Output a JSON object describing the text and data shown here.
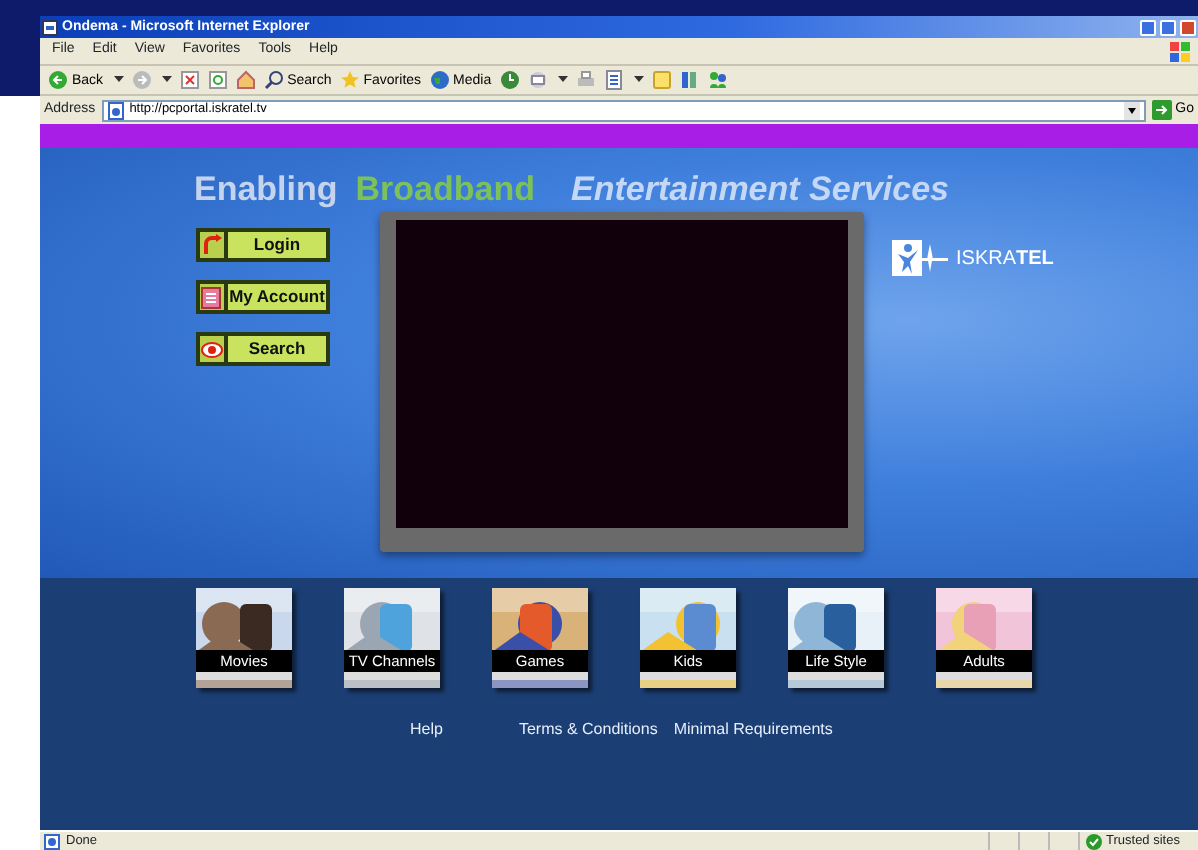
{
  "window": {
    "title": "Ondema - Microsoft Internet Explorer"
  },
  "menu": [
    "File",
    "Edit",
    "View",
    "Favorites",
    "Tools",
    "Help"
  ],
  "toolbar": [
    {
      "kind": "back",
      "label": "Back",
      "has_menu": true
    },
    {
      "kind": "forward",
      "has_menu": true
    },
    {
      "kind": "stop",
      "has_menu": false
    },
    {
      "kind": "refresh",
      "has_menu": false
    },
    {
      "kind": "home",
      "has_menu": false
    },
    {
      "kind": "search",
      "label": "Search",
      "has_menu": false
    },
    {
      "kind": "favorites",
      "label": "Favorites",
      "has_menu": false
    },
    {
      "kind": "media",
      "label": "Media",
      "has_menu": false
    },
    {
      "kind": "history",
      "has_menu": false
    },
    {
      "kind": "mail",
      "has_menu": true
    },
    {
      "kind": "print",
      "has_menu": false
    },
    {
      "kind": "edit",
      "has_menu": true
    },
    {
      "kind": "note",
      "has_menu": false
    },
    {
      "kind": "research",
      "has_menu": false
    },
    {
      "kind": "messenger",
      "has_menu": false
    }
  ],
  "address": {
    "label": "Address",
    "value": "http://pcportal.iskratel.tv",
    "go": "Go"
  },
  "page": {
    "headline": [
      {
        "kind": "plain",
        "text": "Enabling"
      },
      {
        "kind": "accent",
        "text": "Broadband"
      },
      {
        "kind": "italic",
        "text": "Entertainment Services"
      }
    ],
    "buttons": [
      {
        "kind": "login",
        "label": "Login"
      },
      {
        "kind": "account",
        "label": "My Account"
      },
      {
        "kind": "search",
        "label": "Search"
      }
    ],
    "logo": {
      "text": "ISKRA**TEL**"
    },
    "categories": [
      {
        "label": "Movies",
        "kind": "picture"
      },
      {
        "label": "TV Channels",
        "kind": "picture"
      },
      {
        "label": "Games",
        "kind": "picture"
      },
      {
        "label": "Kids",
        "kind": "picture"
      },
      {
        "label": "Life Style",
        "kind": "picture"
      },
      {
        "label": "Adults",
        "kind": "picture"
      }
    ],
    "footer_links": [
      "Help",
      "Terms & Conditions",
      "Minimal Requirements"
    ]
  },
  "status_bar": {
    "text": "Done",
    "zone": "Trusted sites"
  }
}
